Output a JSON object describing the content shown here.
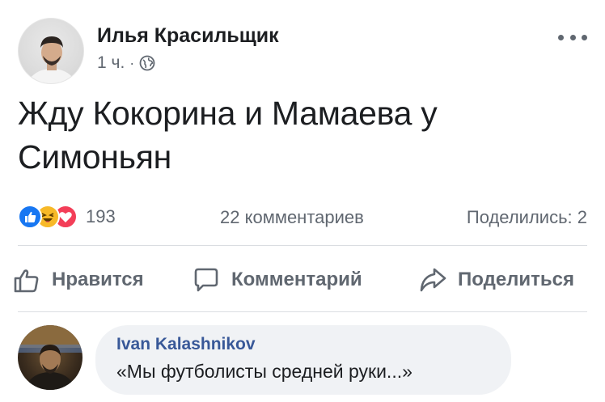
{
  "post": {
    "author": "Илья Красильщик",
    "time": "1 ч.",
    "separator": "·",
    "privacy_icon": "globe-icon",
    "more_icon": "ellipsis-icon",
    "text": "Жду Кокорина и Мамаева у Симоньян"
  },
  "stats": {
    "reactions": [
      "like",
      "haha",
      "love"
    ],
    "reaction_count": "193",
    "comments": "22 комментариев",
    "shares": "Поделились: 2"
  },
  "actions": {
    "like_label": "Нравится",
    "comment_label": "Комментарий",
    "share_label": "Поделиться"
  },
  "comment": {
    "author": "Ivan Kalashnikov",
    "text": "«Мы футболисты средней руки...»"
  },
  "colors": {
    "like_blue": "#1877f2",
    "haha_yellow": "#f7b928",
    "love_red": "#f33e58",
    "secondary_text": "#606770",
    "comment_author": "#385898",
    "bubble_bg": "#f0f2f5"
  }
}
